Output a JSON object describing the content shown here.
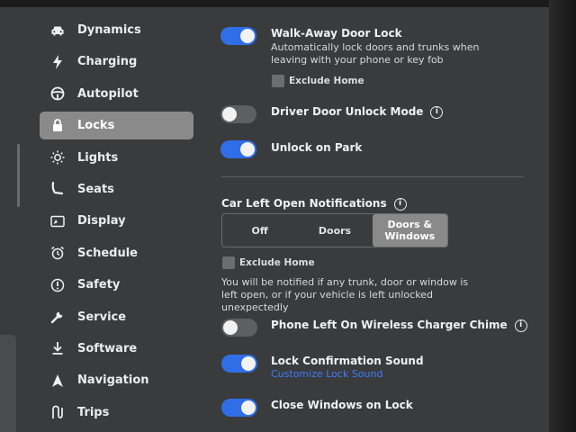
{
  "sidebar": {
    "items": [
      {
        "label": "Dynamics",
        "icon": "car-icon"
      },
      {
        "label": "Charging",
        "icon": "bolt-icon"
      },
      {
        "label": "Autopilot",
        "icon": "steering-wheel-icon"
      },
      {
        "label": "Locks",
        "icon": "lock-icon",
        "active": true
      },
      {
        "label": "Lights",
        "icon": "sun-icon"
      },
      {
        "label": "Seats",
        "icon": "seat-icon"
      },
      {
        "label": "Display",
        "icon": "display-icon"
      },
      {
        "label": "Schedule",
        "icon": "alarm-clock-icon"
      },
      {
        "label": "Safety",
        "icon": "alert-circle-icon"
      },
      {
        "label": "Service",
        "icon": "wrench-icon"
      },
      {
        "label": "Software",
        "icon": "download-icon"
      },
      {
        "label": "Navigation",
        "icon": "navigation-arrow-icon"
      },
      {
        "label": "Trips",
        "icon": "trips-icon"
      }
    ]
  },
  "locks": {
    "walk_away": {
      "label": "Walk-Away Door Lock",
      "description": "Automatically lock doors and trunks when leaving with your phone or key fob",
      "enabled": true,
      "exclude_home_label": "Exclude Home"
    },
    "driver_door_unlock": {
      "label": "Driver Door Unlock Mode",
      "enabled": false
    },
    "unlock_on_park": {
      "label": "Unlock on Park",
      "enabled": true
    },
    "car_left_open": {
      "label": "Car Left Open Notifications",
      "options": [
        "Off",
        "Doors",
        "Doors & Windows"
      ],
      "selected": "Doors & Windows",
      "exclude_home_label": "Exclude Home",
      "description": "You will be notified if any trunk, door or window is left open, or if your vehicle is left unlocked unexpectedly"
    },
    "phone_left_chime": {
      "label": "Phone Left On Wireless Charger Chime",
      "enabled": false
    },
    "lock_confirmation_sound": {
      "label": "Lock Confirmation Sound",
      "enabled": true,
      "link": "Customize Lock Sound"
    },
    "close_windows_on_lock": {
      "label": "Close Windows on Lock",
      "enabled": true
    }
  },
  "colors": {
    "background": "#3a3b3d",
    "toggle_on": "#2f6ee6",
    "toggle_off": "#5e5f61",
    "selected": "#8a8a8a",
    "link": "#3c7dff"
  }
}
